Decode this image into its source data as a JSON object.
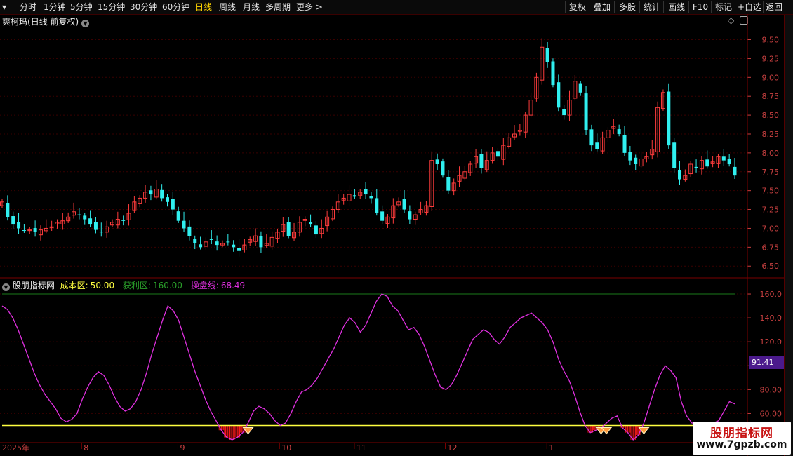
{
  "toolbar": {
    "periods": [
      "分时",
      "1分钟",
      "5分钟",
      "15分钟",
      "30分钟",
      "60分钟",
      "日线",
      "周线",
      "月线",
      "多周期",
      "更多 >"
    ],
    "active_period": "日线",
    "buttons": [
      "复权",
      "叠加",
      "多股",
      "统计",
      "画线",
      "F10",
      "标记",
      "+自选",
      "返回"
    ]
  },
  "main_panel": {
    "stock_name": "爽柯玛",
    "mode": "(日线 前复权)",
    "price_ticks": [
      "9.50",
      "9.25",
      "9.00",
      "8.75",
      "8.50",
      "8.25",
      "8.00",
      "7.75",
      "7.50",
      "7.25",
      "7.00",
      "6.75",
      "6.50"
    ]
  },
  "indicator_panel": {
    "name": "股朋指标网",
    "cost_label": "成本区:",
    "cost_value": "50.00",
    "profit_label": "获利区:",
    "profit_value": "160.00",
    "line_label": "操盘线:",
    "line_value": "68.49",
    "ticks": [
      "160.0",
      "140.0",
      "120.0",
      "100.0",
      "80.00",
      "60.00"
    ],
    "current_tag": "91.41"
  },
  "date_axis": {
    "labels": [
      "2025年",
      "8",
      "9",
      "10",
      "11",
      "12",
      "1"
    ]
  },
  "watermark": {
    "line1": "股朋指标网",
    "line2": "www.7gpzb.com"
  },
  "colors": {
    "up": "#ff3c3c",
    "down": "#30f0f0",
    "line": "#e030e0",
    "cost_line": "#ffff40",
    "profit_line": "#1a7a1a",
    "bar": "#ff1a1a"
  },
  "chart_data": {
    "type": "candlestick",
    "ylim": [
      6.4,
      9.7
    ],
    "indicator_ylim": [
      35,
      170
    ],
    "cost_level": 50,
    "profit_level": 160,
    "close": [
      7.35,
      7.15,
      7.05,
      7.0,
      6.97,
      6.98,
      6.95,
      6.98,
      7.0,
      7.02,
      7.08,
      7.1,
      7.15,
      7.22,
      7.18,
      7.12,
      7.05,
      6.98,
      6.95,
      7.02,
      7.08,
      7.12,
      7.1,
      7.2,
      7.35,
      7.4,
      7.48,
      7.45,
      7.52,
      7.4,
      7.35,
      7.25,
      7.1,
      7.0,
      6.9,
      6.8,
      6.75,
      6.82,
      6.85,
      6.78,
      6.8,
      6.82,
      6.75,
      6.7,
      6.78,
      6.85,
      6.9,
      6.75,
      6.8,
      6.88,
      6.95,
      7.05,
      6.9,
      6.95,
      7.08,
      7.12,
      7.05,
      6.92,
      7.0,
      7.15,
      7.25,
      7.35,
      7.4,
      7.45,
      7.42,
      7.48,
      7.45,
      7.4,
      7.2,
      7.1,
      7.15,
      7.3,
      7.35,
      7.25,
      7.12,
      7.18,
      7.25,
      7.3,
      7.9,
      7.85,
      7.7,
      7.5,
      7.6,
      7.7,
      7.75,
      7.85,
      7.95,
      7.8,
      7.9,
      8.0,
      7.95,
      8.1,
      8.2,
      8.25,
      8.3,
      8.5,
      8.7,
      9.0,
      9.4,
      9.2,
      8.9,
      8.6,
      8.5,
      8.7,
      8.95,
      8.8,
      8.3,
      8.1,
      8.05,
      8.2,
      8.3,
      8.35,
      8.25,
      8.0,
      7.9,
      7.85,
      7.92,
      7.95,
      8.05,
      8.6,
      8.8,
      8.1,
      7.8,
      7.65,
      7.7,
      7.85,
      7.8,
      7.9,
      7.82,
      7.88,
      7.95,
      7.9,
      7.85,
      7.7
    ],
    "indicator": [
      150,
      147,
      140,
      130,
      118,
      106,
      94,
      84,
      76,
      70,
      64,
      56,
      53,
      55,
      60,
      72,
      82,
      90,
      95,
      92,
      84,
      74,
      66,
      62,
      64,
      70,
      80,
      94,
      110,
      124,
      138,
      150,
      146,
      138,
      124,
      110,
      96,
      84,
      72,
      62,
      54,
      46,
      40,
      38,
      40,
      44,
      52,
      62,
      66,
      64,
      60,
      54,
      50,
      52,
      60,
      70,
      78,
      80,
      84,
      90,
      98,
      106,
      114,
      124,
      134,
      140,
      136,
      128,
      134,
      144,
      154,
      160,
      158,
      150,
      146,
      138,
      130,
      132,
      126,
      116,
      104,
      92,
      82,
      80,
      84,
      92,
      102,
      112,
      122,
      126,
      130,
      128,
      122,
      118,
      124,
      132,
      136,
      140,
      142,
      144,
      140,
      136,
      130,
      120,
      106,
      96,
      88,
      76,
      62,
      50,
      44,
      46,
      48,
      52,
      56,
      58,
      48,
      44,
      38,
      42,
      52,
      66,
      80,
      92,
      100,
      96,
      90,
      70,
      58,
      52,
      52,
      52,
      52,
      52,
      54,
      62,
      70,
      68
    ],
    "ticks": [
      "2025年",
      "8",
      "9",
      "10",
      "11",
      "12",
      "1"
    ]
  }
}
